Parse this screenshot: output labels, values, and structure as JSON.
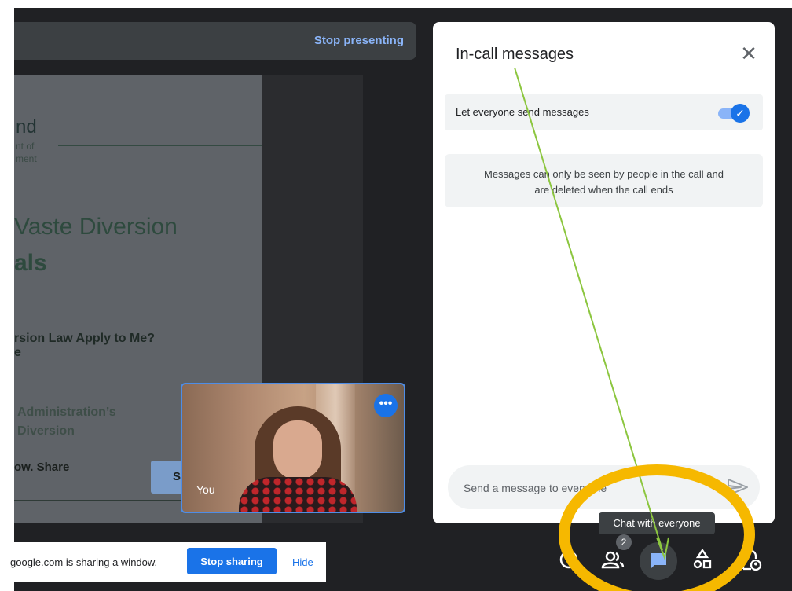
{
  "presenting": {
    "stop_label": "Stop presenting"
  },
  "slide": {
    "logo_text": "nd",
    "logo_sub": "nt of\nment",
    "title_line1": "Vaste Diversion",
    "title_line2": "als",
    "question": "rsion Law Apply to Me?",
    "fragment": "e",
    "admin_line1": "Administration’s",
    "admin_line2": "Diversion",
    "now_share": "ow. Share",
    "button_letter": "S"
  },
  "self_tile": {
    "label": "You",
    "more_icon": "more-options-icon"
  },
  "chat": {
    "title": "In-call messages",
    "setting_label": "Let everyone send messages",
    "setting_enabled": true,
    "info_line1": "Messages can only be seen by people in the call and",
    "info_line2": "are deleted when the call ends",
    "input_placeholder": "Send a message to everyone"
  },
  "tooltip": {
    "text": "Chat with everyone"
  },
  "sharing": {
    "text": "google.com is sharing a window.",
    "stop_label": "Stop sharing",
    "hide_label": "Hide"
  },
  "controls": {
    "people_count": "2",
    "items": [
      "info-icon",
      "people-icon",
      "chat-icon",
      "activities-icon",
      "host-controls-icon"
    ]
  },
  "colors": {
    "accent": "#1a73e8",
    "link": "#8ab4f8",
    "annotation_circle": "#f6b800",
    "annotation_arrow": "#8cc63f"
  }
}
